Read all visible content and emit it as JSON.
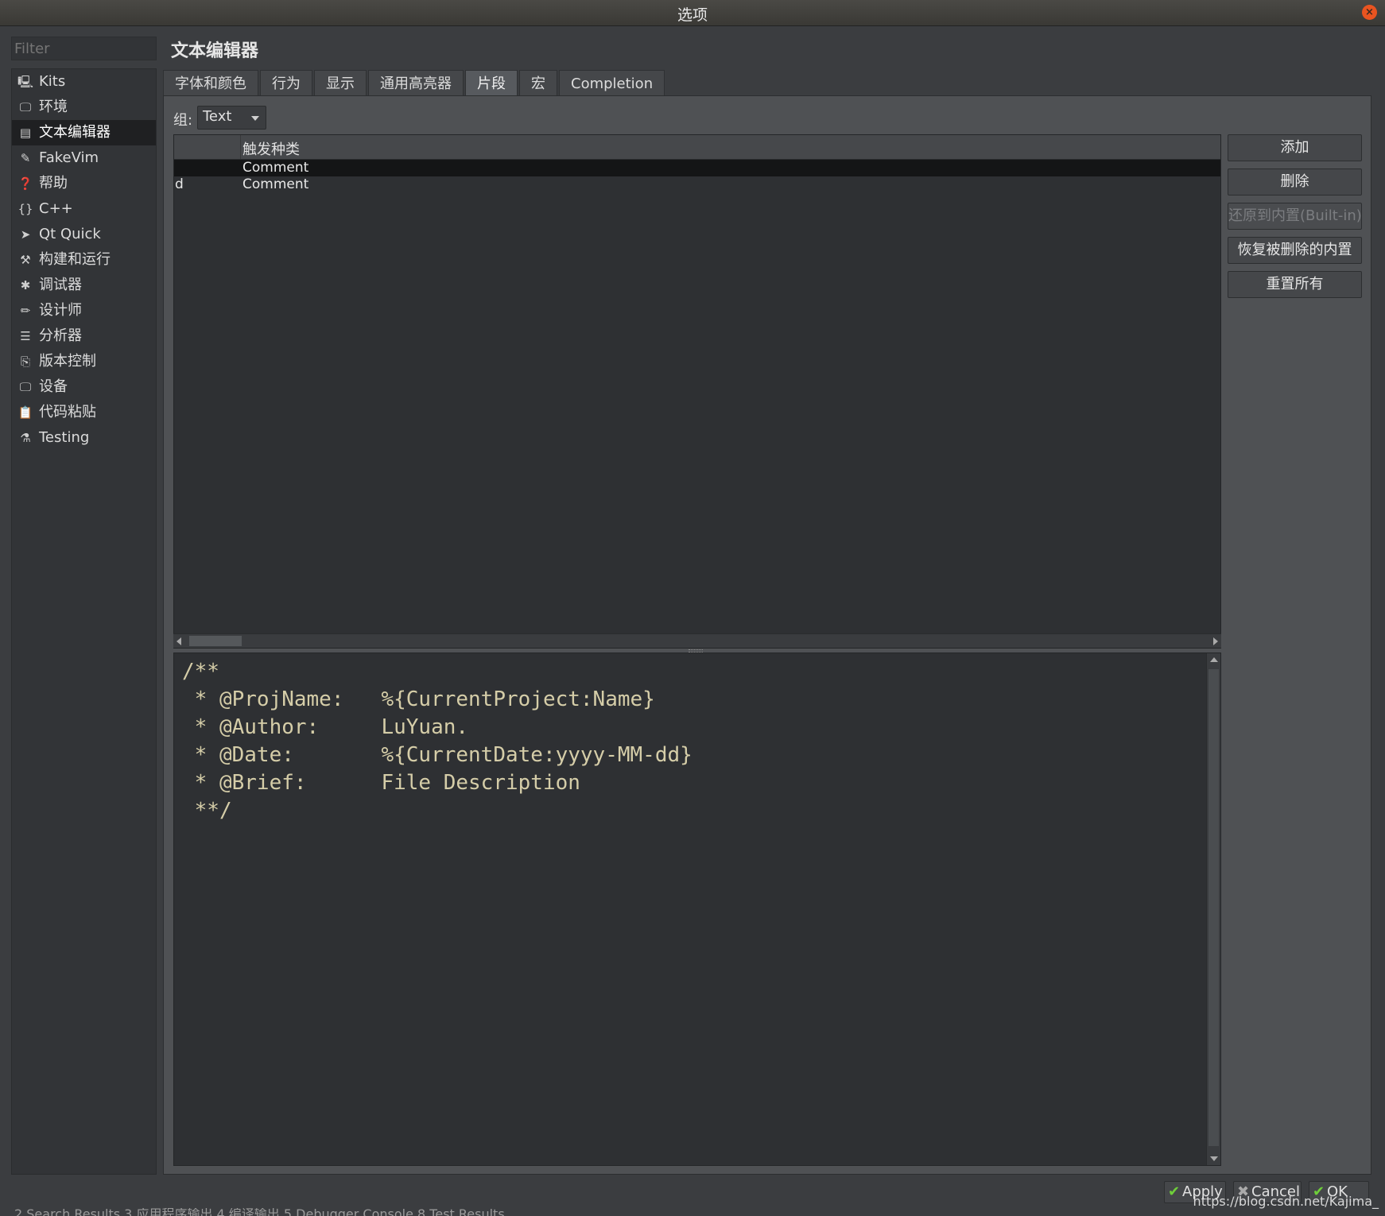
{
  "window": {
    "title": "选项",
    "close_icon": "close-icon"
  },
  "filter": {
    "placeholder": "Filter"
  },
  "sidebar": {
    "items": [
      {
        "label": "Kits",
        "icon": "kits-icon",
        "glyph": "🖳"
      },
      {
        "label": "环境",
        "icon": "monitor-icon",
        "glyph": "🖵"
      },
      {
        "label": "文本编辑器",
        "icon": "text-editor-icon",
        "glyph": "▤"
      },
      {
        "label": "FakeVim",
        "icon": "fakevim-icon",
        "glyph": "✎"
      },
      {
        "label": "帮助",
        "icon": "help-icon",
        "glyph": "❓"
      },
      {
        "label": "C++",
        "icon": "braces-icon",
        "glyph": "{}"
      },
      {
        "label": "Qt Quick",
        "icon": "qtquick-icon",
        "glyph": "➤"
      },
      {
        "label": "构建和运行",
        "icon": "hammer-icon",
        "glyph": "⚒"
      },
      {
        "label": "调试器",
        "icon": "bug-icon",
        "glyph": "✱"
      },
      {
        "label": "设计师",
        "icon": "pencil-icon",
        "glyph": "✏"
      },
      {
        "label": "分析器",
        "icon": "analyzer-icon",
        "glyph": "☰"
      },
      {
        "label": "版本控制",
        "icon": "version-control-icon",
        "glyph": "⎘"
      },
      {
        "label": "设备",
        "icon": "device-icon",
        "glyph": "🖵"
      },
      {
        "label": "代码粘贴",
        "icon": "clipboard-icon",
        "glyph": "📋"
      },
      {
        "label": "Testing",
        "icon": "flask-icon",
        "glyph": "⚗"
      }
    ],
    "selected_index": 2
  },
  "main": {
    "title": "文本编辑器",
    "tabs": [
      {
        "label": "字体和颜色"
      },
      {
        "label": "行为"
      },
      {
        "label": "显示"
      },
      {
        "label": "通用高亮器"
      },
      {
        "label": "片段",
        "active": true
      },
      {
        "label": "宏"
      },
      {
        "label": "Completion"
      }
    ],
    "group": {
      "label": "组:",
      "value": "Text"
    },
    "table": {
      "columns": [
        "",
        "触发种类"
      ],
      "rows": [
        {
          "trigger": "",
          "kind": "Comment",
          "selected": true
        },
        {
          "trigger": "d",
          "kind": "Comment",
          "selected": false
        }
      ]
    },
    "editor": {
      "lines": [
        "/**",
        " * @ProjName:   %{CurrentProject:Name}",
        " * @Author:     LuYuan.",
        " * @Date:       %{CurrentDate:yyyy-MM-dd}",
        " * @Brief:      File Description",
        " **/"
      ]
    },
    "buttons": {
      "add": "添加",
      "remove": "删除",
      "revert_builtin": "还原到内置(Built-in)",
      "restore_removed": "恢复被删除的内置",
      "reset_all": "重置所有"
    }
  },
  "footer": {
    "apply": "Apply",
    "cancel": "Cancel",
    "ok": "OK",
    "watermark": "https://blog.csdn.net/Kajima_",
    "status_text": "2 Search Results   3 应用程序输出   4 编译输出   5 Debugger Console   8 Test Results"
  }
}
